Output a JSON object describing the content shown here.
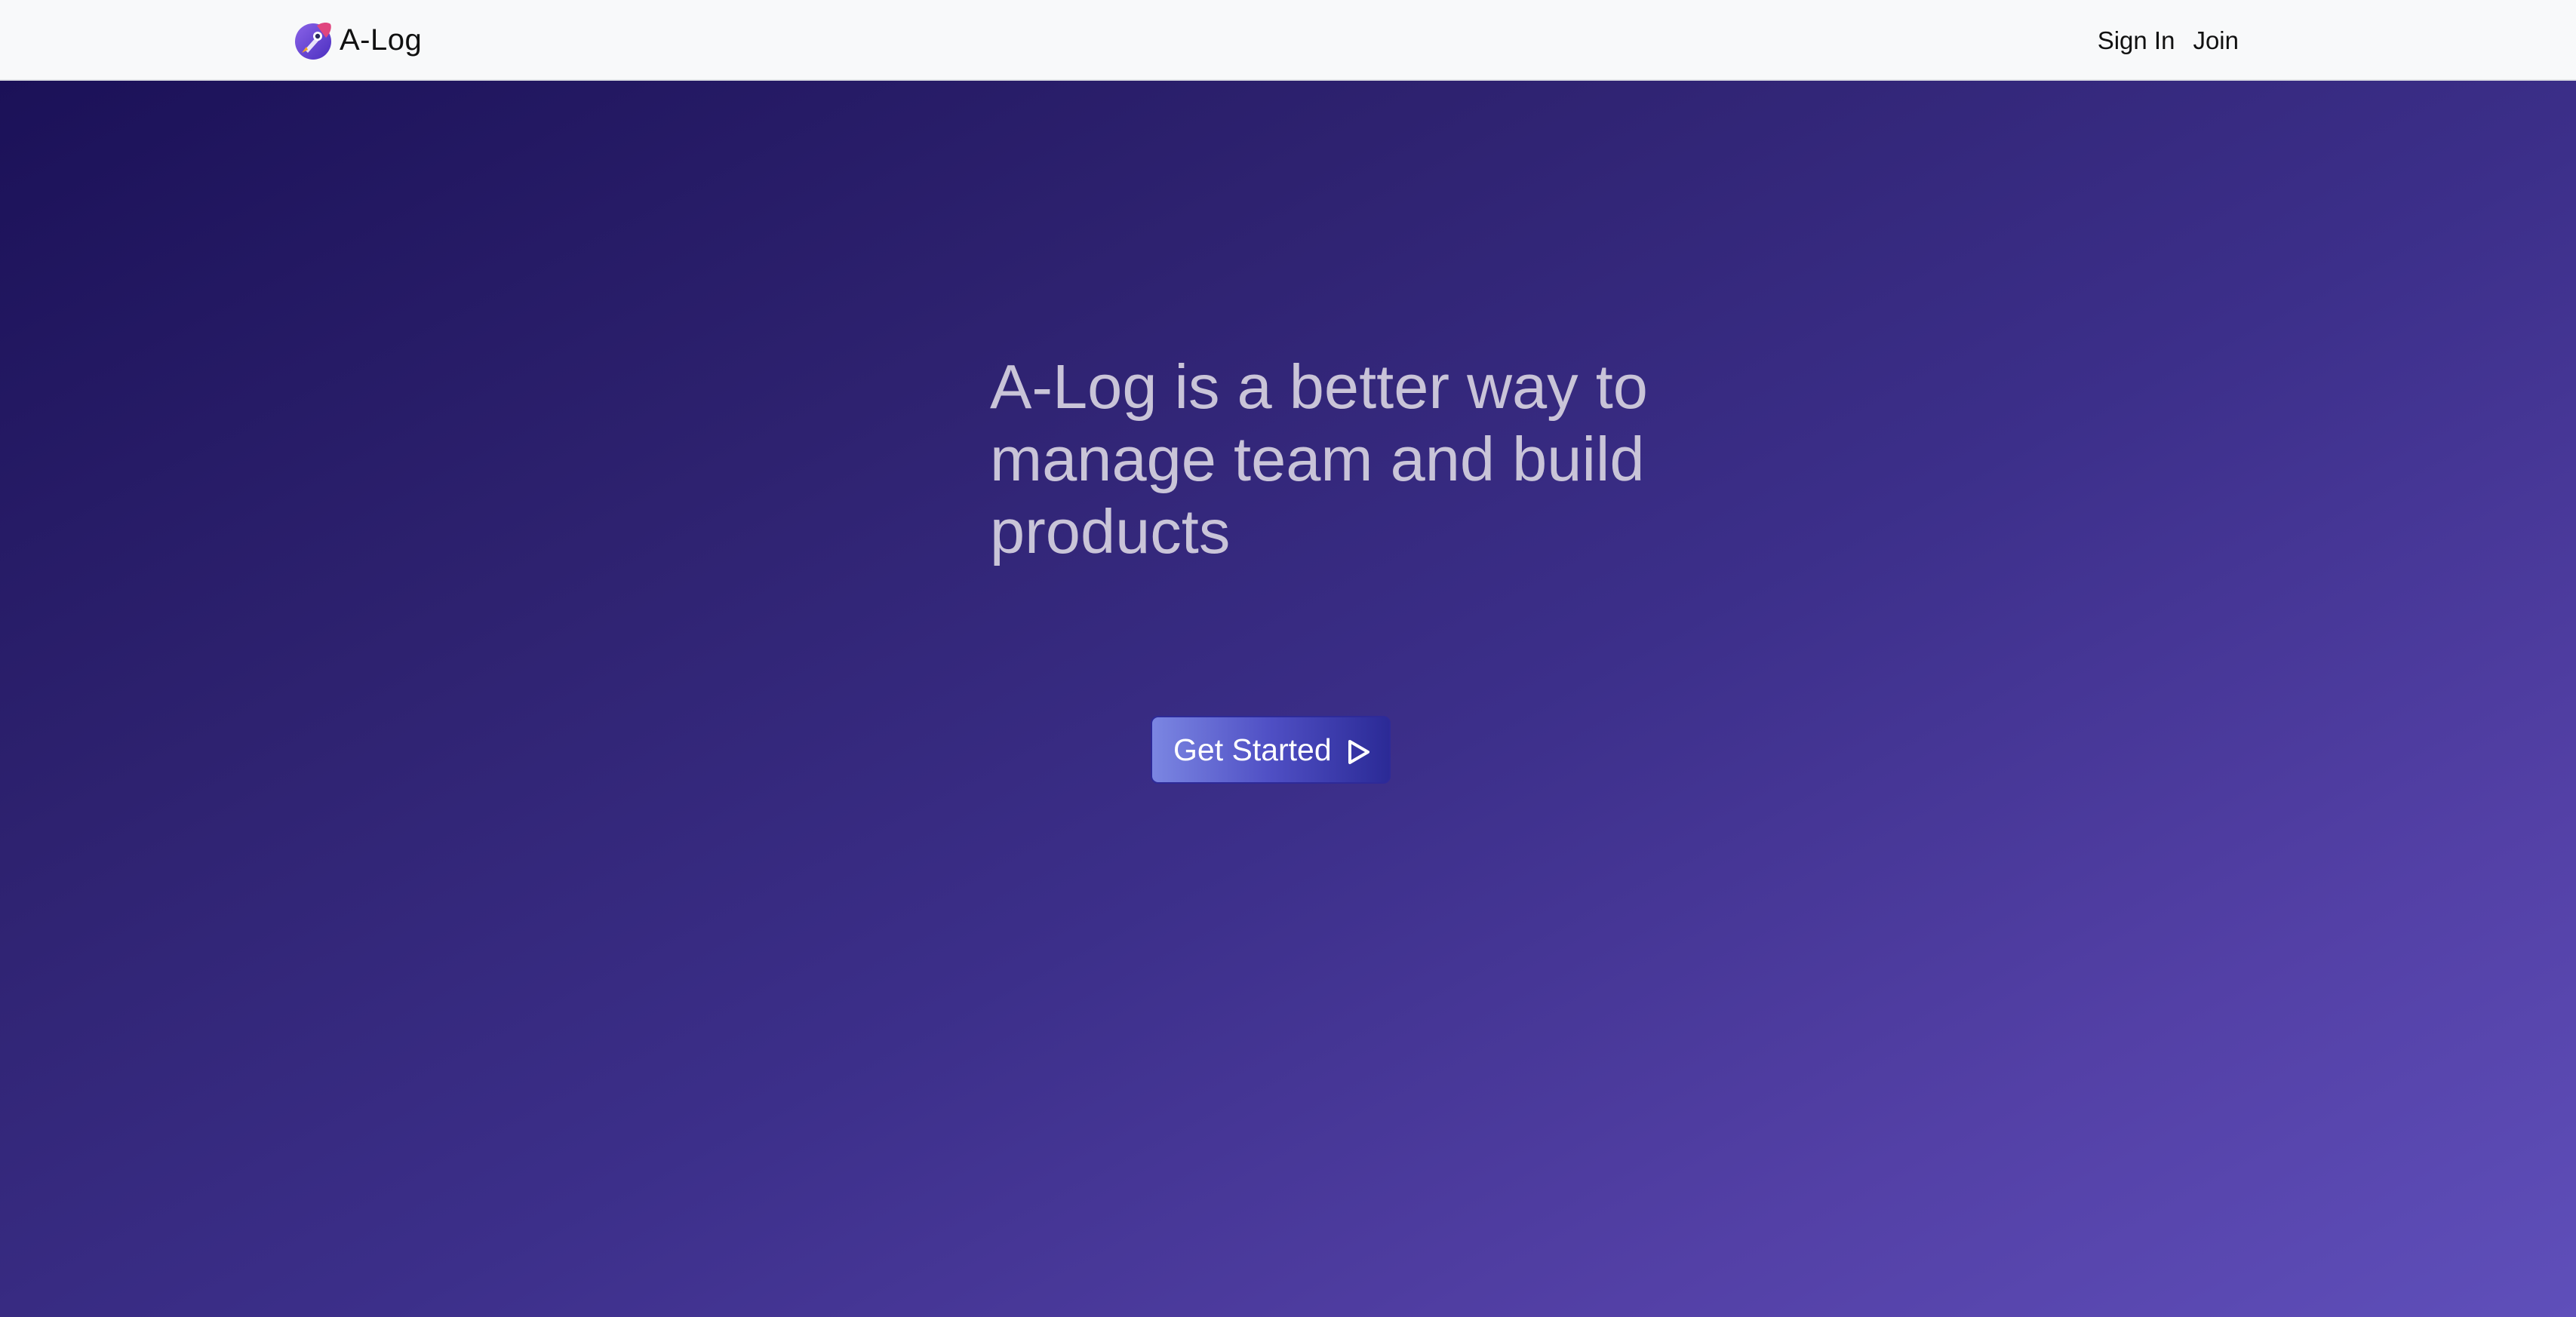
{
  "nav": {
    "brand_name": "A-Log",
    "sign_in": "Sign In",
    "join": "Join"
  },
  "hero": {
    "headline": "A-Log is a better way to manage team and build products",
    "cta_label": "Get Started"
  },
  "icons": {
    "brand": "rocket-logo-icon",
    "cta": "play-triangle-icon"
  },
  "colors": {
    "navbar_bg": "#f8f9fa",
    "hero_gradient_start": "#1b1158",
    "hero_gradient_end": "#5f4fba",
    "headline_text": "#c9c4d8",
    "cta_gradient_start": "#7b86e2",
    "cta_gradient_end": "#2b2a96"
  }
}
